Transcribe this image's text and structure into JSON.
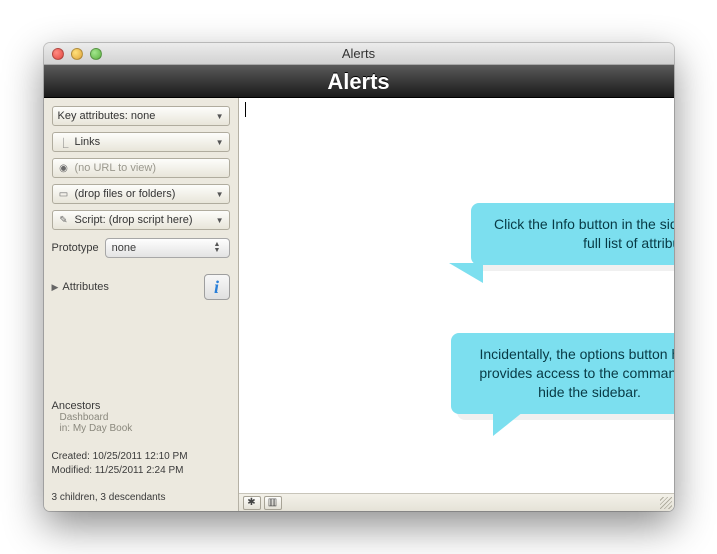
{
  "window": {
    "title": "Alerts"
  },
  "header": {
    "title": "Alerts"
  },
  "sidebar": {
    "keyAttributes": "Key attributes: none",
    "links": "Links",
    "urlPlaceholder": "(no URL to view)",
    "filesPlaceholder": "(drop files or folders)",
    "scriptPlaceholder": "Script: (drop script here)",
    "prototypeLabel": "Prototype",
    "prototypeValue": "none",
    "attributesLabel": "Attributes",
    "ancestorsHeading": "Ancestors",
    "ancestorsItem": "Dashboard",
    "ancestorsIn": "in: My Day Book",
    "created": "Created: 10/25/2011 12:10 PM",
    "modified": "Modified: 11/25/2011 2:24 PM",
    "counts": "3 children, 3 descendants"
  },
  "callouts": {
    "c1": "Click the Info button in the sidebar to access the full list of attributes.",
    "c2": "Incidentally, the options button here provides access to the command to hide the sidebar."
  },
  "icons": {
    "links": "⎿",
    "globe": "◉",
    "file": "▭",
    "script": "✎",
    "gear": "✱",
    "display": "▥"
  }
}
